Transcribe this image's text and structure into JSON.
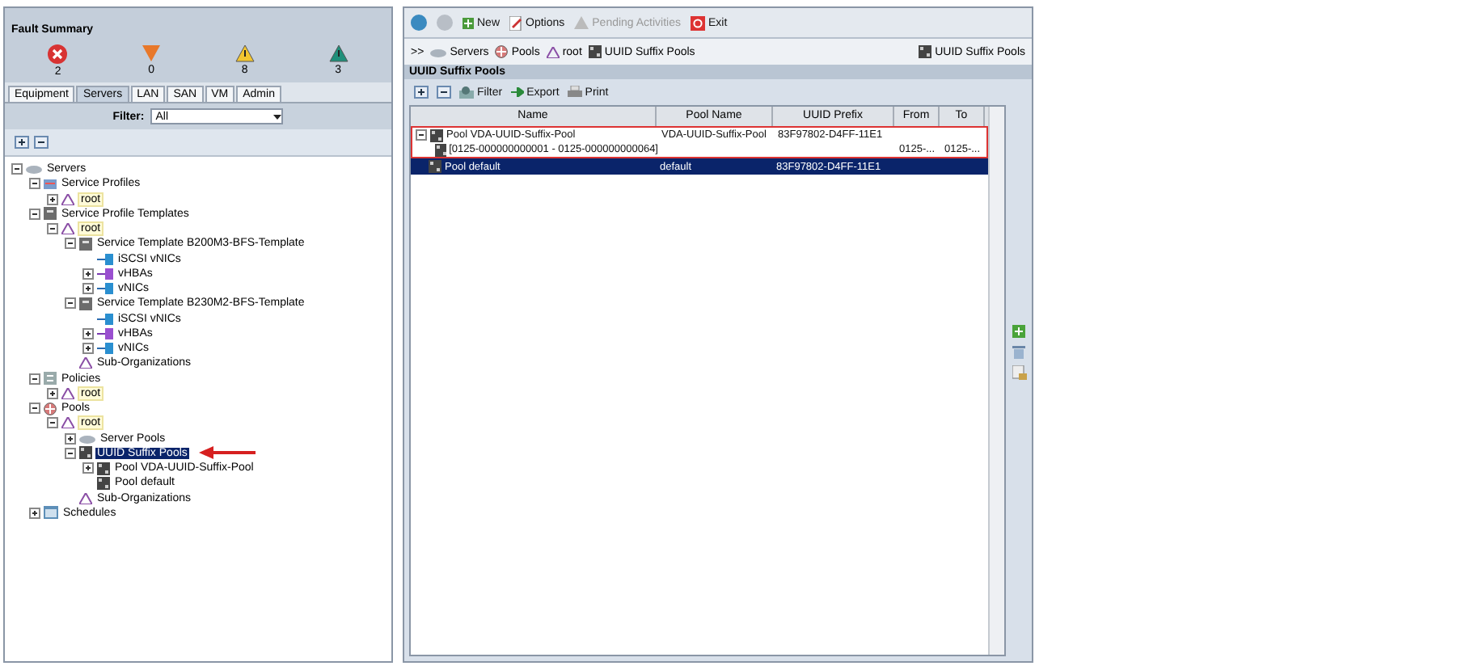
{
  "fault_summary": {
    "title": "Fault Summary",
    "faults": [
      {
        "kind": "critical",
        "count": "2"
      },
      {
        "kind": "major",
        "count": "0"
      },
      {
        "kind": "minor",
        "count": "8"
      },
      {
        "kind": "warning",
        "count": "3"
      }
    ]
  },
  "nav_tabs": [
    {
      "label": "Equipment",
      "selected": false
    },
    {
      "label": "Servers",
      "selected": true
    },
    {
      "label": "LAN",
      "selected": false
    },
    {
      "label": "SAN",
      "selected": false
    },
    {
      "label": "VM",
      "selected": false
    },
    {
      "label": "Admin",
      "selected": false
    }
  ],
  "filter": {
    "label": "Filter:",
    "value": "All"
  },
  "tree": [
    {
      "label": "Servers",
      "kind": "server",
      "expanded": true,
      "children": [
        {
          "label": "Service Profiles",
          "kind": "profile",
          "expanded": true,
          "children": [
            {
              "label": "root",
              "kind": "org",
              "expanded": false
            }
          ]
        },
        {
          "label": "Service Profile Templates",
          "kind": "template",
          "expanded": true,
          "children": [
            {
              "label": "root",
              "kind": "org",
              "expanded": true,
              "children": [
                {
                  "label": "Service Template B200M3-BFS-Template",
                  "kind": "template",
                  "expanded": true,
                  "children": [
                    {
                      "label": "iSCSI vNICs",
                      "kind": "nic"
                    },
                    {
                      "label": "vHBAs",
                      "kind": "hba",
                      "expanded": false
                    },
                    {
                      "label": "vNICs",
                      "kind": "nic",
                      "expanded": false
                    }
                  ]
                },
                {
                  "label": "Service Template B230M2-BFS-Template",
                  "kind": "template",
                  "expanded": true,
                  "children": [
                    {
                      "label": "iSCSI vNICs",
                      "kind": "nic"
                    },
                    {
                      "label": "vHBAs",
                      "kind": "hba",
                      "expanded": false
                    },
                    {
                      "label": "vNICs",
                      "kind": "nic",
                      "expanded": false
                    }
                  ]
                },
                {
                  "label": "Sub-Organizations",
                  "kind": "suborg"
                }
              ]
            }
          ]
        },
        {
          "label": "Policies",
          "kind": "policy",
          "expanded": true,
          "children": [
            {
              "label": "root",
              "kind": "org",
              "expanded": false
            }
          ]
        },
        {
          "label": "Pools",
          "kind": "pool",
          "expanded": true,
          "children": [
            {
              "label": "root",
              "kind": "org",
              "expanded": true,
              "children": [
                {
                  "label": "Server Pools",
                  "kind": "server",
                  "expanded": false
                },
                {
                  "label": "UUID Suffix Pools",
                  "kind": "uuid",
                  "expanded": true,
                  "selected": true,
                  "pointer": true,
                  "children": [
                    {
                      "label": "Pool VDA-UUID-Suffix-Pool",
                      "kind": "uuid",
                      "expanded": false
                    },
                    {
                      "label": "Pool default",
                      "kind": "uuid"
                    }
                  ]
                },
                {
                  "label": "Sub-Organizations",
                  "kind": "suborg"
                }
              ]
            }
          ]
        },
        {
          "label": "Schedules",
          "kind": "schedule",
          "expanded": false
        }
      ]
    }
  ],
  "toolbar": [
    {
      "label": "New",
      "kind": "new"
    },
    {
      "label": "Options",
      "kind": "options"
    },
    {
      "label": "Pending Activities",
      "kind": "pending",
      "disabled": true
    },
    {
      "label": "Exit",
      "kind": "exit"
    }
  ],
  "breadcrumb": {
    "prefix": ">>",
    "items": [
      {
        "label": "Servers",
        "kind": "server"
      },
      {
        "label": "Pools",
        "kind": "pool"
      },
      {
        "label": "root",
        "kind": "org"
      },
      {
        "label": "UUID Suffix Pools",
        "kind": "uuid"
      }
    ],
    "current": "UUID Suffix Pools"
  },
  "panel_title": "UUID Suffix Pools",
  "table_tools": [
    {
      "label": "Filter",
      "kind": "filter"
    },
    {
      "label": "Export",
      "kind": "export"
    },
    {
      "label": "Print",
      "kind": "print"
    }
  ],
  "table": {
    "columns": [
      "Name",
      "Pool Name",
      "UUID Prefix",
      "From",
      "To"
    ],
    "rows": [
      {
        "name": "Pool VDA-UUID-Suffix-Pool",
        "pool_name": "VDA-UUID-Suffix-Pool",
        "prefix": "83F97802-D4FF-11E1",
        "child": false,
        "expanded": true,
        "selected": false,
        "outlined": true
      },
      {
        "name": "[0125-000000000001 - 0125-000000000064]",
        "from": "0125-...",
        "to": "0125-...",
        "child": true,
        "selected": false,
        "outlined": true
      },
      {
        "name": "Pool default",
        "pool_name": "default",
        "prefix": "83F97802-D4FF-11E1",
        "child": false,
        "selected": true,
        "outlined": false
      }
    ]
  }
}
